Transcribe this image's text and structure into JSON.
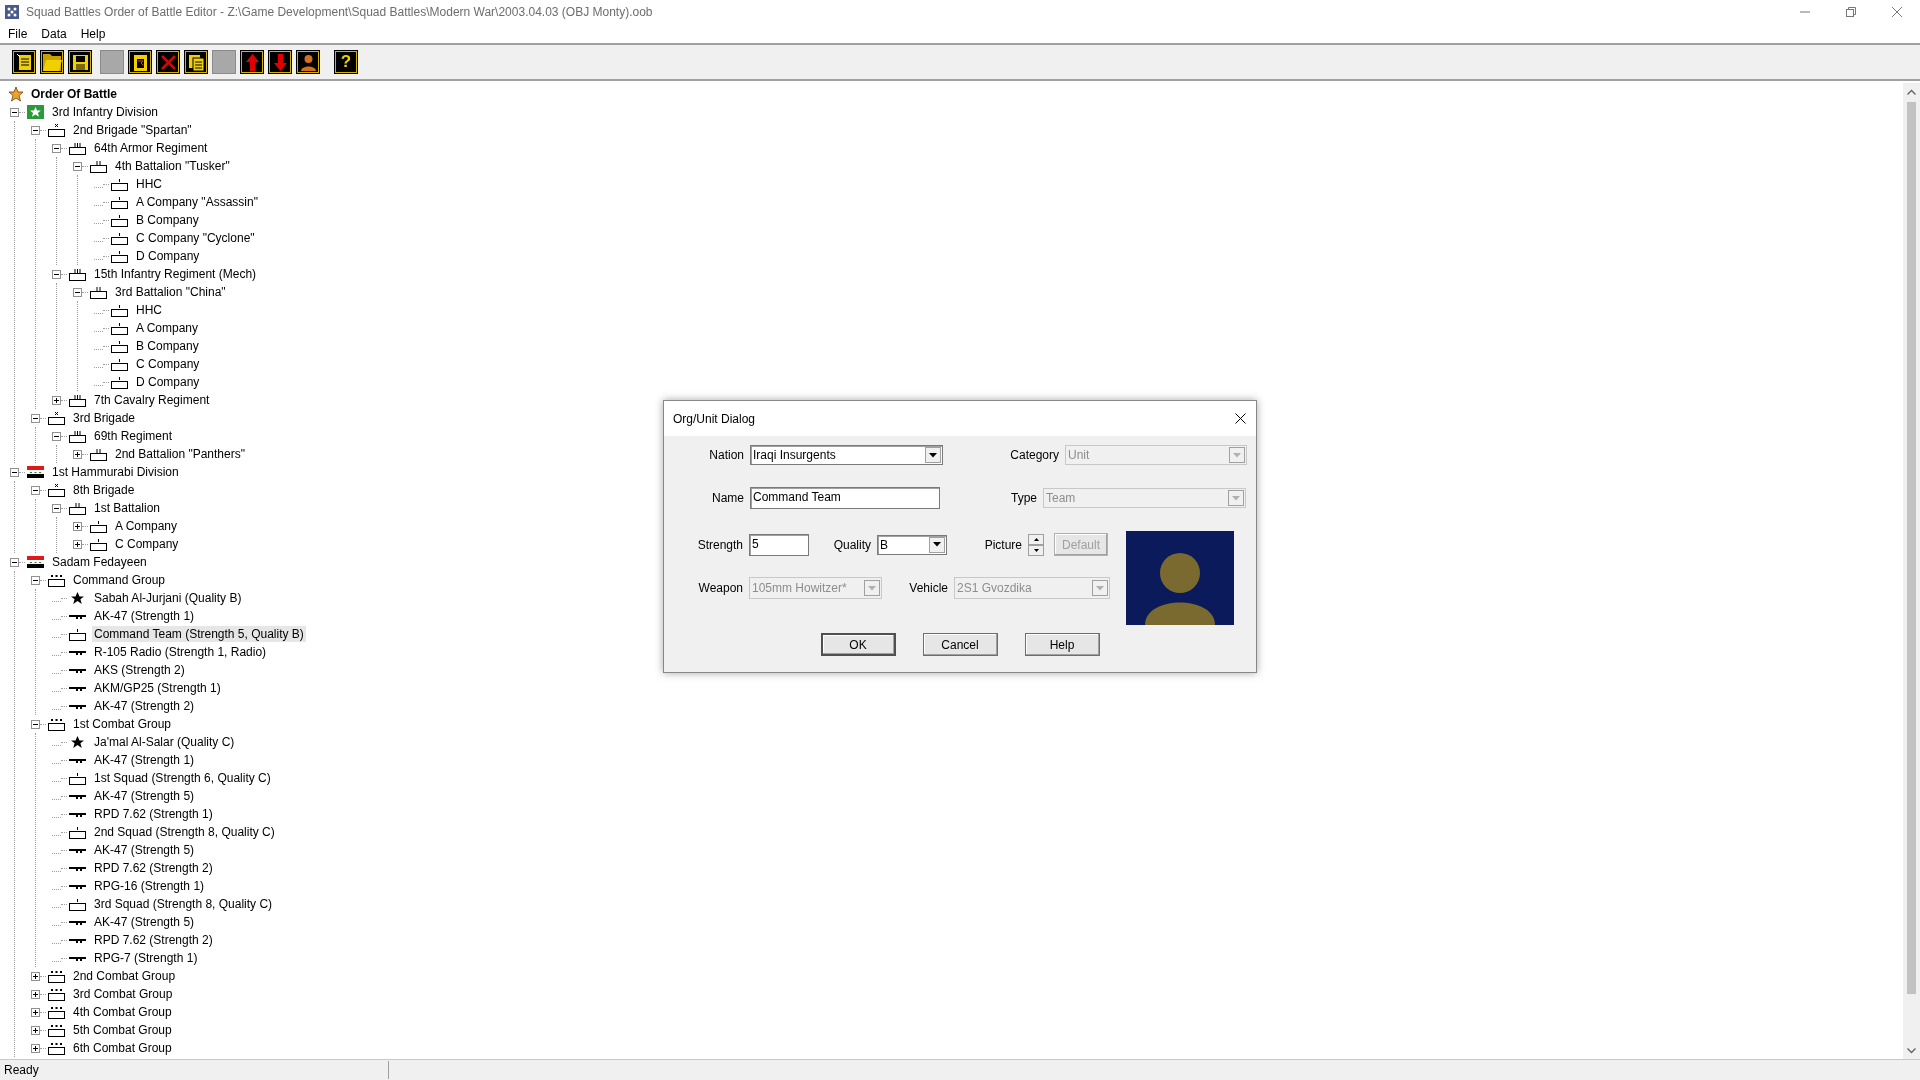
{
  "window": {
    "title": "Squad Battles Order of Battle Editor - Z:\\Game Development\\Squad Battles\\Modern War\\2003.04.03 (OBJ Monty).oob"
  },
  "menu": [
    "File",
    "Data",
    "Help"
  ],
  "toolbar": [
    [
      {
        "kind": "new"
      },
      {
        "kind": "open"
      },
      {
        "kind": "save"
      }
    ],
    [
      {
        "kind": "blank"
      },
      {
        "kind": "paste"
      },
      {
        "kind": "delete"
      },
      {
        "kind": "copy"
      },
      {
        "kind": "blank"
      },
      {
        "kind": "up"
      },
      {
        "kind": "down"
      },
      {
        "kind": "person"
      }
    ],
    [
      {
        "kind": "help",
        "glyph": "?"
      }
    ]
  ],
  "tree": {
    "root": {
      "label": "Order Of Battle",
      "kind": "root",
      "selected": false
    },
    "nodes": [
      {
        "label": "3rd Infantry Division",
        "kind": "division-us",
        "expanded": true,
        "selected": false,
        "children": [
          {
            "label": "2nd Brigade \"Spartan\"",
            "kind": "brigade",
            "expanded": true,
            "selected": false,
            "children": [
              {
                "label": "64th Armor Regiment",
                "kind": "regiment",
                "expanded": true,
                "selected": false,
                "children": [
                  {
                    "label": "4th Battalion \"Tusker\"",
                    "kind": "battalion",
                    "expanded": true,
                    "selected": false,
                    "children": [
                      {
                        "label": "HHC",
                        "kind": "company",
                        "selected": false
                      },
                      {
                        "label": "A Company \"Assassin\"",
                        "kind": "company",
                        "selected": false
                      },
                      {
                        "label": "B Company",
                        "kind": "company",
                        "selected": false
                      },
                      {
                        "label": "C Company \"Cyclone\"",
                        "kind": "company",
                        "selected": false
                      },
                      {
                        "label": "D Company",
                        "kind": "company",
                        "selected": false
                      }
                    ]
                  }
                ]
              },
              {
                "label": "15th Infantry Regiment (Mech)",
                "kind": "regiment",
                "expanded": true,
                "selected": false,
                "children": [
                  {
                    "label": "3rd Battalion \"China\"",
                    "kind": "battalion",
                    "expanded": true,
                    "selected": false,
                    "children": [
                      {
                        "label": "HHC",
                        "kind": "company",
                        "selected": false
                      },
                      {
                        "label": "A Company",
                        "kind": "company",
                        "selected": false
                      },
                      {
                        "label": "B Company",
                        "kind": "company",
                        "selected": false
                      },
                      {
                        "label": "C Company",
                        "kind": "company",
                        "selected": false
                      },
                      {
                        "label": "D Company",
                        "kind": "company",
                        "selected": false
                      }
                    ]
                  }
                ]
              },
              {
                "label": "7th Cavalry Regiment",
                "kind": "regiment",
                "expanded": false,
                "selected": false
              }
            ]
          },
          {
            "label": "3rd Brigade",
            "kind": "brigade",
            "expanded": true,
            "selected": false,
            "children": [
              {
                "label": "69th Regiment",
                "kind": "regiment",
                "expanded": true,
                "selected": false,
                "children": [
                  {
                    "label": "2nd Battalion \"Panthers\"",
                    "kind": "battalion",
                    "expanded": false,
                    "selected": false
                  }
                ]
              }
            ]
          }
        ]
      },
      {
        "label": "1st Hammurabi Division",
        "kind": "division-iraq",
        "expanded": true,
        "selected": false,
        "children": [
          {
            "label": "8th Brigade",
            "kind": "brigade",
            "expanded": true,
            "selected": false,
            "children": [
              {
                "label": "1st Battalion",
                "kind": "battalion",
                "expanded": true,
                "selected": false,
                "children": [
                  {
                    "label": "A Company",
                    "kind": "company",
                    "expanded": false,
                    "selected": false
                  },
                  {
                    "label": "C Company",
                    "kind": "company",
                    "expanded": false,
                    "selected": false
                  }
                ]
              }
            ]
          }
        ]
      },
      {
        "label": "Sadam Fedayeen",
        "kind": "division-iraq",
        "expanded": true,
        "selected": false,
        "children": [
          {
            "label": "Command Group",
            "kind": "group",
            "expanded": true,
            "selected": false,
            "children": [
              {
                "label": "Sabah Al-Jurjani (Quality B)",
                "kind": "leader",
                "selected": false
              },
              {
                "label": "AK-47 (Strength 1)",
                "kind": "weapon",
                "selected": false
              },
              {
                "label": "Command Team (Strength 5, Quality B)",
                "kind": "company",
                "selected": true
              },
              {
                "label": "R-105 Radio (Strength 1, Radio)",
                "kind": "weapon",
                "selected": false
              },
              {
                "label": "AKS (Strength 2)",
                "kind": "weapon",
                "selected": false
              },
              {
                "label": "AKM/GP25 (Strength 1)",
                "kind": "weapon",
                "selected": false
              },
              {
                "label": "AK-47 (Strength 2)",
                "kind": "weapon",
                "selected": false
              }
            ]
          },
          {
            "label": "1st Combat Group",
            "kind": "group",
            "expanded": true,
            "selected": false,
            "children": [
              {
                "label": "Ja'mal Al-Salar (Quality C)",
                "kind": "leader",
                "selected": false
              },
              {
                "label": "AK-47 (Strength 1)",
                "kind": "weapon",
                "selected": false
              },
              {
                "label": "1st Squad (Strength 6, Quality C)",
                "kind": "company",
                "selected": false
              },
              {
                "label": "AK-47 (Strength 5)",
                "kind": "weapon",
                "selected": false
              },
              {
                "label": "RPD 7.62 (Strength 1)",
                "kind": "weapon",
                "selected": false
              },
              {
                "label": "2nd Squad (Strength 8, Quality C)",
                "kind": "company",
                "selected": false
              },
              {
                "label": "AK-47 (Strength 5)",
                "kind": "weapon",
                "selected": false
              },
              {
                "label": "RPD 7.62 (Strength 2)",
                "kind": "weapon",
                "selected": false
              },
              {
                "label": "RPG-16 (Strength 1)",
                "kind": "weapon",
                "selected": false
              },
              {
                "label": "3rd Squad (Strength 8, Quality C)",
                "kind": "company",
                "selected": false
              },
              {
                "label": "AK-47 (Strength 5)",
                "kind": "weapon",
                "selected": false
              },
              {
                "label": "RPD 7.62 (Strength 2)",
                "kind": "weapon",
                "selected": false
              },
              {
                "label": "RPG-7 (Strength 1)",
                "kind": "weapon",
                "selected": false
              }
            ]
          },
          {
            "label": "2nd Combat Group",
            "kind": "group",
            "expanded": false,
            "selected": false
          },
          {
            "label": "3rd Combat Group",
            "kind": "group",
            "expanded": false,
            "selected": false
          },
          {
            "label": "4th Combat Group",
            "kind": "group",
            "expanded": false,
            "selected": false
          },
          {
            "label": "5th Combat Group",
            "kind": "group",
            "expanded": false,
            "selected": false
          },
          {
            "label": "6th Combat Group",
            "kind": "group",
            "expanded": false,
            "selected": false
          }
        ]
      }
    ]
  },
  "dialog": {
    "title": "Org/Unit Dialog",
    "rows": [
      [
        {
          "kind": "dropdown",
          "label": "Nation",
          "value": "Iraqi Insurgents",
          "disabled": false
        },
        {
          "kind": "dropdown",
          "label": "Category",
          "value": "Unit",
          "disabled": true
        }
      ],
      [
        {
          "kind": "text",
          "label": "Name",
          "value": "Command Team",
          "disabled": false
        },
        {
          "kind": "dropdown",
          "label": "Type",
          "value": "Team",
          "disabled": true
        }
      ],
      [
        {
          "kind": "text",
          "label": "Strength",
          "value": "5",
          "disabled": false
        },
        {
          "kind": "dropdown",
          "label": "Quality",
          "value": "B",
          "disabled": false
        },
        {
          "kind": "spinner",
          "label": "Picture",
          "disabled": false
        },
        {
          "kind": "button",
          "value": "Default",
          "disabled": true
        }
      ],
      [
        {
          "kind": "dropdown",
          "label": "Weapon",
          "value": "105mm Howitzer*",
          "disabled": true
        },
        {
          "kind": "dropdown",
          "label": "Vehicle",
          "value": "2S1 Gvozdika",
          "disabled": true
        }
      ]
    ],
    "buttons": [
      {
        "label": "OK",
        "default": true
      },
      {
        "label": "Cancel",
        "default": false
      },
      {
        "label": "Help",
        "default": false
      }
    ]
  },
  "status_bar": {
    "text": "Ready"
  }
}
